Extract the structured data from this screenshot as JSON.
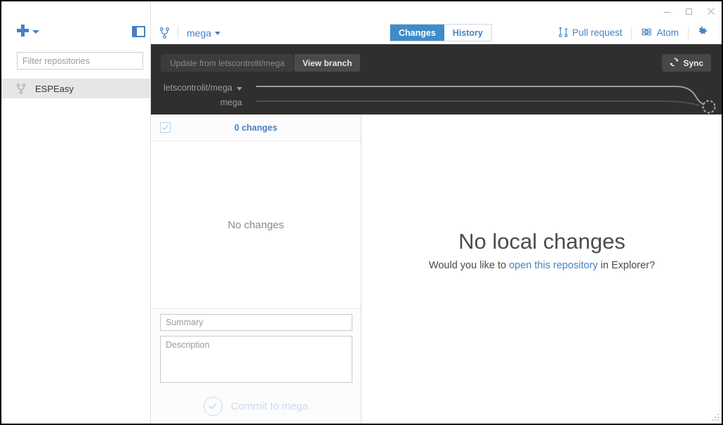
{
  "window": {
    "controls": [
      {
        "name": "minimize-button",
        "glyph": "minimize"
      },
      {
        "name": "maximize-button",
        "glyph": "maximize"
      },
      {
        "name": "close-button",
        "glyph": "close"
      }
    ]
  },
  "sidebar": {
    "add_repo_label": "",
    "add_icon": "plus-icon",
    "toggle_icon": "sidebar-toggle-icon",
    "filter": {
      "value": "",
      "placeholder": "Filter repositories"
    },
    "repos": [
      {
        "label": "ESPEasy",
        "icon": "branch-icon",
        "selected": true
      }
    ]
  },
  "toolbar": {
    "branch_icon": "branch-icon",
    "repo_name": "mega",
    "tabs": [
      {
        "label": "Changes",
        "active": true
      },
      {
        "label": "History",
        "active": false
      }
    ],
    "actions": [
      {
        "label": "Pull request",
        "icon": "pull-request-icon"
      },
      {
        "label": "Atom",
        "icon": "atom-icon"
      }
    ],
    "settings_icon": "gear-icon"
  },
  "branch_bar": {
    "update_button": "Update from letscontrolit/mega",
    "view_branch_button": "View branch",
    "sync_button": "Sync",
    "sync_icon": "sync-icon",
    "graph_rows": [
      {
        "label": "letscontrolit/mega",
        "has_caret": true
      },
      {
        "label": "mega",
        "has_caret": false
      }
    ],
    "colors": {
      "background": "#2f2f2f",
      "line": "#9b9b9b",
      "line_dark": "#545454"
    }
  },
  "changes_panel": {
    "select_all_checkbox": {
      "name": "select-all-changes-checkbox",
      "checked": true
    },
    "count_label": "0 changes",
    "empty_text": "No changes",
    "summary": {
      "value": "",
      "placeholder": "Summary"
    },
    "description": {
      "value": "",
      "placeholder": "Description"
    },
    "commit_button": {
      "label": "Commit to mega",
      "enabled": false,
      "icon": "check-circle-icon"
    }
  },
  "main_pane": {
    "title": "No local changes",
    "sub_prefix": "Would you like to ",
    "sub_link": "open this repository",
    "sub_suffix": " in Explorer?"
  },
  "colors": {
    "accent_blue": "#4680c2",
    "tab_active_bg": "#3f8ccb",
    "dark_bar": "#2f2f2f",
    "sidebar_selected": "#e6e6e6",
    "disabled_blue": "#ccdcee"
  }
}
